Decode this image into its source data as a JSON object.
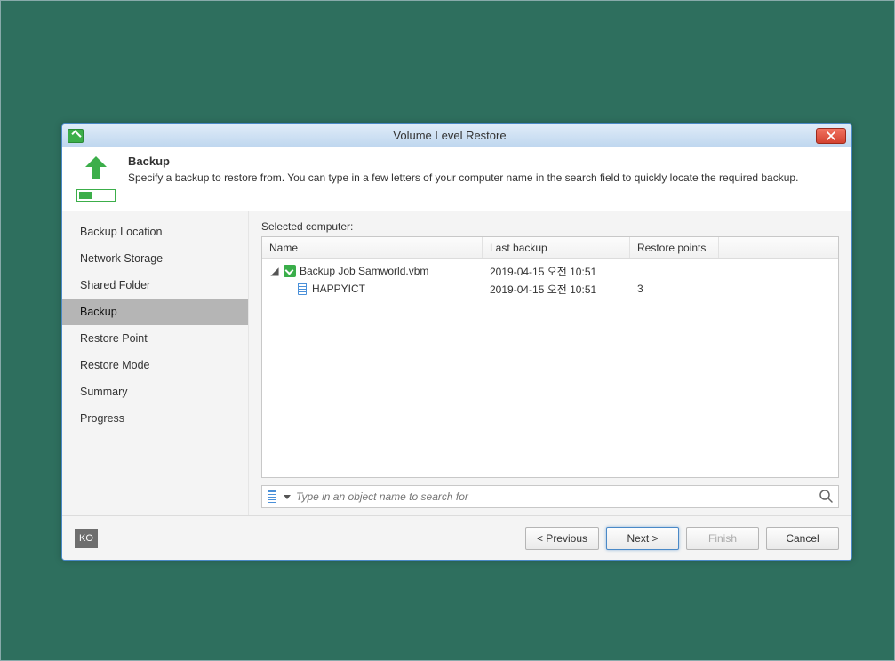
{
  "window": {
    "title": "Volume Level Restore"
  },
  "header": {
    "title": "Backup",
    "description": "Specify a backup to restore from. You can type in a few letters of your computer name in the search field to quickly locate the required backup."
  },
  "sidebar": {
    "items": [
      {
        "label": "Backup Location",
        "active": false
      },
      {
        "label": "Network Storage",
        "active": false
      },
      {
        "label": "Shared Folder",
        "active": false
      },
      {
        "label": "Backup",
        "active": true
      },
      {
        "label": "Restore Point",
        "active": false
      },
      {
        "label": "Restore Mode",
        "active": false
      },
      {
        "label": "Summary",
        "active": false
      },
      {
        "label": "Progress",
        "active": false
      }
    ]
  },
  "main": {
    "section_label": "Selected computer:",
    "columns": {
      "name": "Name",
      "last_backup": "Last backup",
      "restore_points": "Restore points"
    },
    "rows": [
      {
        "indent": 0,
        "icon": "job",
        "toggle": "▲",
        "name": "Backup Job Samworld.vbm",
        "last_backup": "2019-04-15 오전 10:51",
        "restore_points": ""
      },
      {
        "indent": 1,
        "icon": "computer",
        "name": "HAPPYICT",
        "last_backup": "2019-04-15 오전 10:51",
        "restore_points": "3"
      }
    ],
    "search_placeholder": "Type in an object name to search for"
  },
  "footer": {
    "lang": "KO",
    "previous": "< Previous",
    "next": "Next >",
    "finish": "Finish",
    "cancel": "Cancel"
  }
}
